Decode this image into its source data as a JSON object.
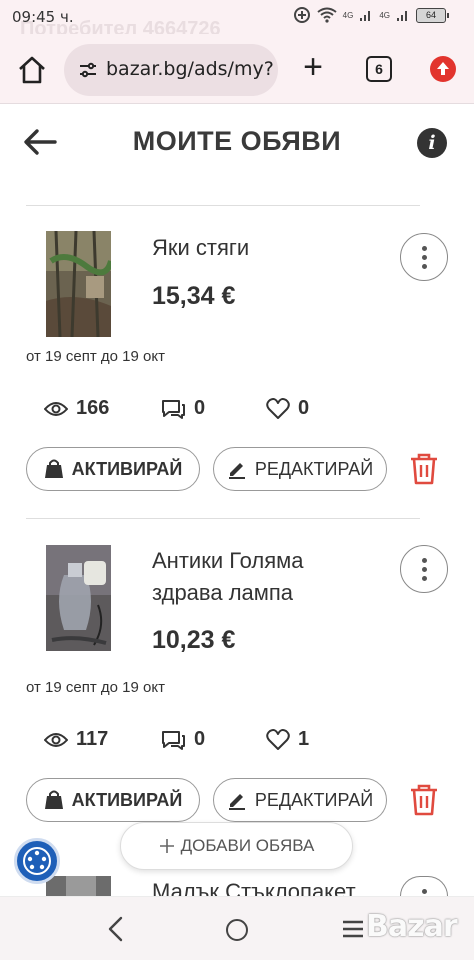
{
  "status_bar": {
    "time": "09:45 ч.",
    "ghost_text": "Потребител 4664726",
    "battery": "64",
    "signal_labels": [
      "4G",
      "4G"
    ]
  },
  "browser": {
    "url": "bazar.bg/ads/my?",
    "tab_count": "6"
  },
  "header": {
    "title": "МОИТЕ ОБЯВИ"
  },
  "ads": [
    {
      "title": "Яки стяги",
      "price": "15,34 €",
      "dates": "от 19 септ до 19 окт",
      "views": "166",
      "messages": "0",
      "likes": "0",
      "activate_label": "АКТИВИРАЙ",
      "edit_label": "РЕДАКТИРАЙ"
    },
    {
      "title": "Антики Голяма здрава лампа",
      "price": "10,23 €",
      "dates": "от 19 септ до 19 окт",
      "views": "117",
      "messages": "0",
      "likes": "1",
      "activate_label": "АКТИВИРАЙ",
      "edit_label": "РЕДАКТИРАЙ"
    },
    {
      "title": "Малък Стъклопакет"
    }
  ],
  "add_ad": {
    "label": "ДОБАВИ ОБЯВА"
  },
  "watermark": "Bazar",
  "colors": {
    "accent_red": "#e2342d",
    "text": "#333333",
    "browser_bg": "#fbf1f3"
  }
}
